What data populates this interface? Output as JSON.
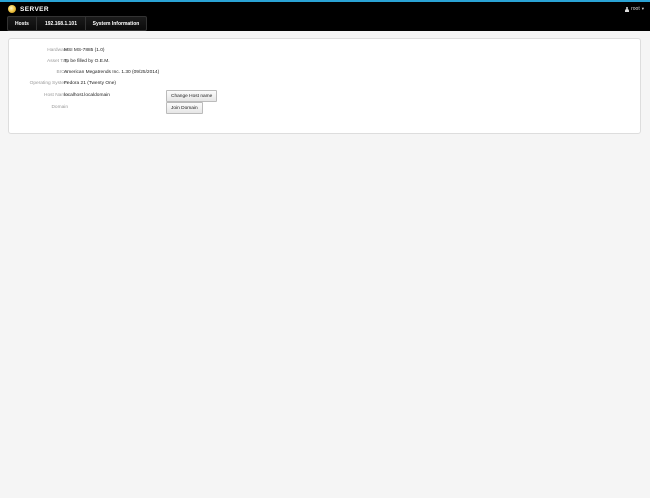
{
  "header": {
    "brand": "SERVER",
    "user": "root",
    "accent_color": "#2aa3d5"
  },
  "nav": {
    "items": [
      {
        "label": "Hosts"
      },
      {
        "label": "192.168.1.101"
      },
      {
        "label": "System Information"
      }
    ]
  },
  "system_info": {
    "hardware": {
      "label": "Hardware",
      "value": "MSI MS-7885 (1.0)"
    },
    "asset_tag": {
      "label": "Asset Tag",
      "value": "To be filled by O.E.M."
    },
    "bios": {
      "label": "BIOS",
      "value": "American Megatrends Inc. 1.30 (09/25/2014)"
    },
    "os": {
      "label": "Operating System",
      "value": "Fedora 21 (Twenty One)"
    },
    "host_name": {
      "label": "Host Name",
      "value": "localhost.localdomain",
      "button": "Change Host name"
    },
    "domain": {
      "label": "Domain",
      "value": "",
      "button": "Join Domain"
    }
  }
}
